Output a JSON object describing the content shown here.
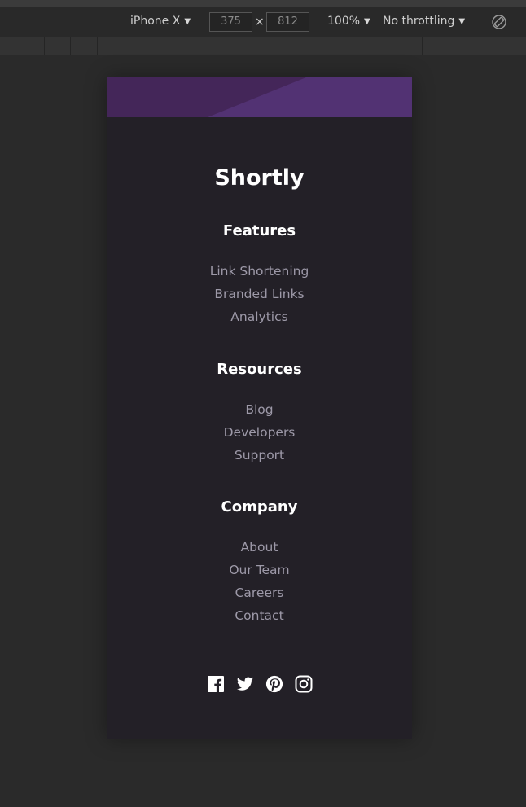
{
  "devtools": {
    "device": "iPhone X",
    "width": "375",
    "height": "812",
    "times_symbol": "×",
    "zoom": "100%",
    "throttling": "No throttling"
  },
  "footer": {
    "brand": "Shortly",
    "sections": [
      {
        "title": "Features",
        "links": [
          "Link Shortening",
          "Branded Links",
          "Analytics"
        ]
      },
      {
        "title": "Resources",
        "links": [
          "Blog",
          "Developers",
          "Support"
        ]
      },
      {
        "title": "Company",
        "links": [
          "About",
          "Our Team",
          "Careers",
          "Contact"
        ]
      }
    ],
    "social_icons": [
      "facebook-icon",
      "twitter-icon",
      "pinterest-icon",
      "instagram-icon"
    ]
  },
  "colors": {
    "banner": "#4b2b66",
    "footer_bg": "#232027",
    "link": "#9d99a8"
  }
}
